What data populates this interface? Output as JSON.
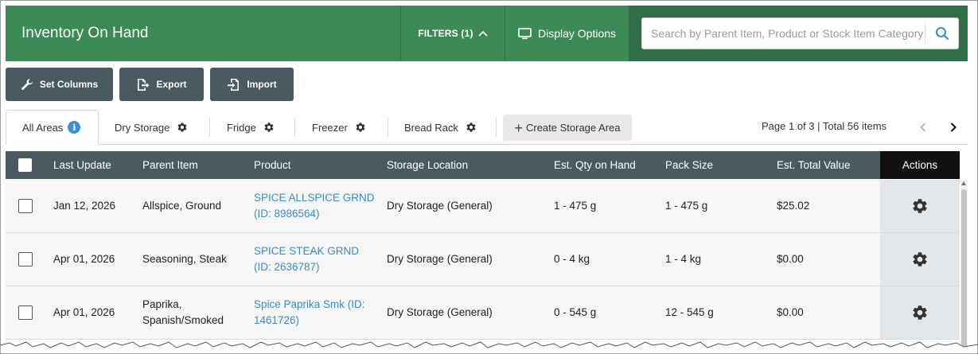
{
  "header": {
    "title": "Inventory On Hand",
    "filters_label": "FILTERS (1)",
    "display_options_label": "Display Options",
    "search_placeholder": "Search by Parent Item, Product or Stock Item Category"
  },
  "toolbar": {
    "set_columns_label": "Set Columns",
    "export_label": "Export",
    "import_label": "Import"
  },
  "tabs": [
    {
      "label": "All Areas",
      "active": true
    },
    {
      "label": "Dry Storage",
      "active": false
    },
    {
      "label": "Fridge",
      "active": false
    },
    {
      "label": "Freezer",
      "active": false
    },
    {
      "label": "Bread Rack",
      "active": false
    }
  ],
  "create_storage_area_label": "Create Storage Area",
  "pager": {
    "text": "Page 1 of 3 | Total 56 items"
  },
  "table": {
    "columns": [
      "Last Update",
      "Parent Item",
      "Product",
      "Storage Location",
      "Est. Qty on Hand",
      "Pack Size",
      "Est. Total Value",
      "Actions"
    ],
    "rows": [
      {
        "last_update": "Jan 12, 2026",
        "parent_item": "Allspice, Ground",
        "product_name": "SPICE ALLSPICE GRND",
        "product_id": "(ID: 8986564)",
        "storage_location": "Dry Storage (General)",
        "qty_on_hand": "1 - 475 g",
        "pack_size": "1 - 475 g",
        "total_value": "$25.02"
      },
      {
        "last_update": "Apr 01, 2026",
        "parent_item": "Seasoning, Steak",
        "product_name": "SPICE STEAK GRND",
        "product_id": "(ID: 2636787)",
        "storage_location": "Dry Storage (General)",
        "qty_on_hand": "0 - 4 kg",
        "pack_size": "1 - 4 kg",
        "total_value": "$0.00"
      },
      {
        "last_update": "Apr 01, 2026",
        "parent_item_line1": "Paprika,",
        "parent_item_line2": "Spanish/Smoked",
        "product_name": "Spice Paprika Smk (ID:",
        "product_id": "1461726)",
        "storage_location": "Dry Storage (General)",
        "qty_on_hand": "0 - 545 g",
        "pack_size": "12 - 545 g",
        "total_value": "$0.00"
      }
    ]
  },
  "colors": {
    "header_green": "#3c8a56",
    "search_panel_green": "#2f6e46",
    "toolbar_button": "#4b5960",
    "table_header": "#4b5960",
    "actions_header": "#111111",
    "link_blue": "#3b8cc4",
    "info_blue": "#3c8fd0"
  },
  "icons": {
    "filters_toggle": "chevron-up-icon",
    "display_options": "monitor-icon",
    "search": "search-icon",
    "set_columns": "wrench-icon",
    "export": "export-icon",
    "import": "import-icon",
    "tab_settings": "gear-icon",
    "info": "info-icon",
    "pager_prev": "chevron-left-icon",
    "pager_next": "chevron-right-icon",
    "row_actions": "gear-icon"
  }
}
